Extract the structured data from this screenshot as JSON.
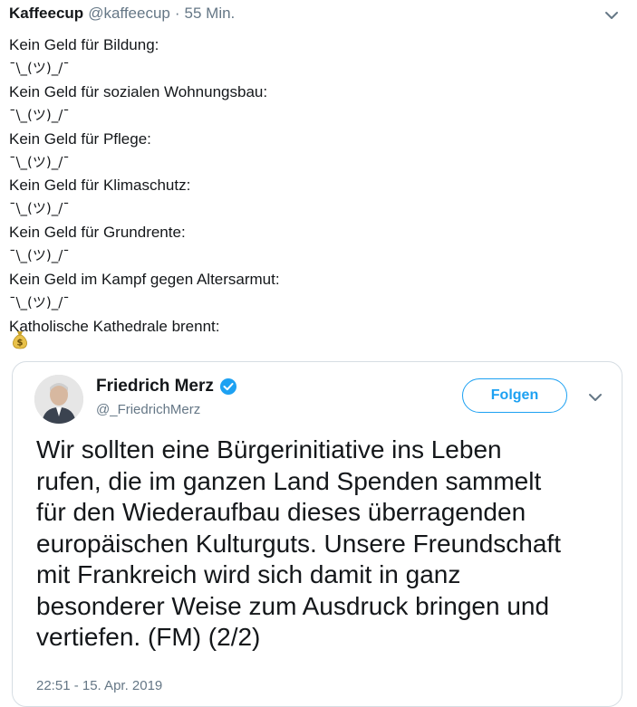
{
  "tweet": {
    "author_name": "Kaffeecup",
    "author_handle": "@kaffeecup",
    "separator": "·",
    "time_ago": "55 Min.",
    "lines": [
      "Kein Geld für Bildung:",
      "¯\\_(ツ)_/¯",
      "Kein Geld für sozialen Wohnungsbau:",
      "¯\\_(ツ)_/¯",
      "Kein Geld für Pflege:",
      "¯\\_(ツ)_/¯",
      "Kein Geld für Klimaschutz:",
      "¯\\_(ツ)_/¯",
      "Kein Geld für Grundrente:",
      "¯\\_(ツ)_/¯",
      "Kein Geld im Kampf gegen Altersarmut:",
      "¯\\_(ツ)_/¯",
      "Katholische Kathedrale brennt:"
    ],
    "emoji_icon": "money-bag-icon"
  },
  "quoted_tweet": {
    "author_name": "Friedrich Merz",
    "author_handle": "@_FriedrichMerz",
    "follow_label": "Folgen",
    "text_lines": [
      "Wir sollten eine Bürgerinitiative ins Leben",
      "rufen, die im ganzen Land Spenden sammelt",
      "für den Wiederaufbau dieses überragenden",
      "europäischen Kulturguts. Unsere Freundschaft",
      "mit Frankreich wird sich damit in ganz",
      "besonderer Weise zum Ausdruck bringen und",
      "vertiefen. (FM) (2/2)"
    ],
    "timestamp": "22:51 - 15. Apr. 2019"
  },
  "colors": {
    "accent": "#1da1f2",
    "muted": "#657786",
    "text": "#14171a",
    "border": "#d6dde3"
  }
}
